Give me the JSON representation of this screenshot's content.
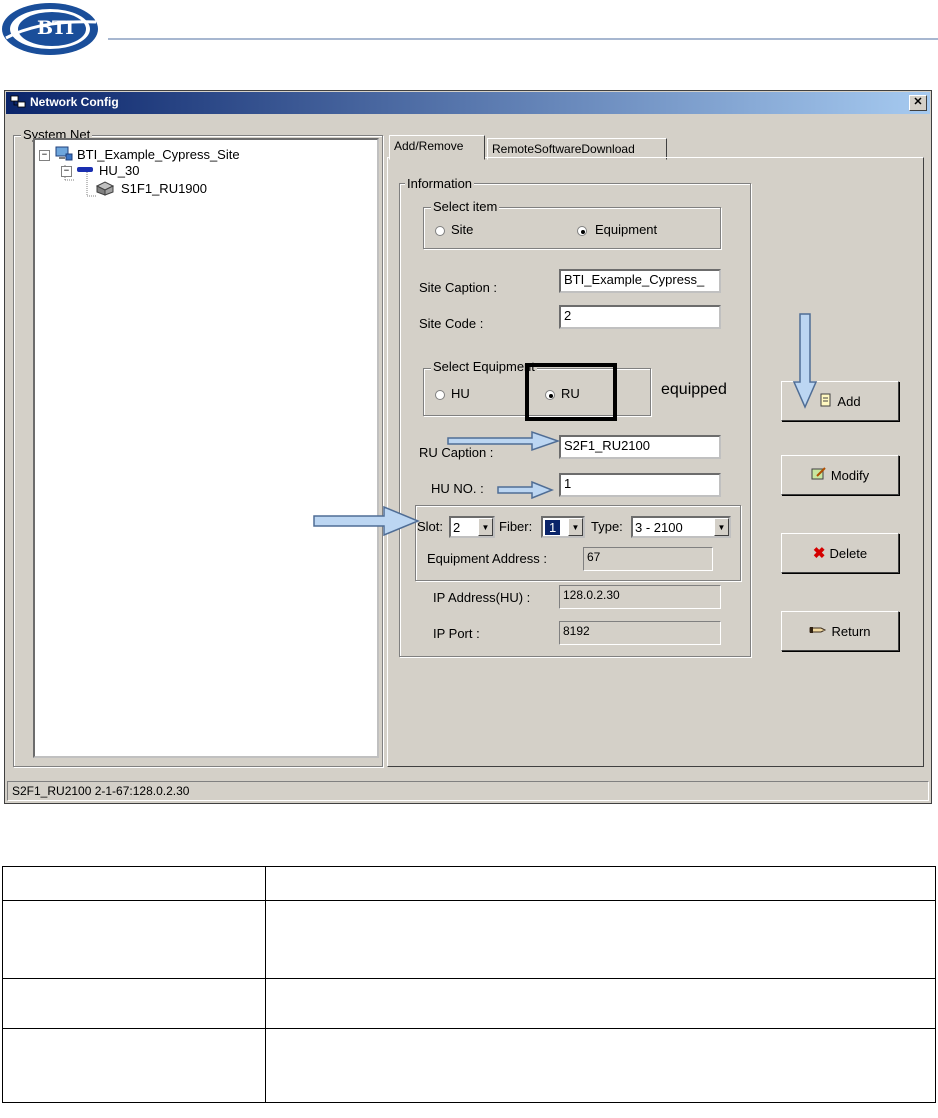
{
  "logo": {
    "text": "BTI"
  },
  "window": {
    "title": "Network Config",
    "close_label": "✕"
  },
  "system_net": {
    "label": "System Net",
    "tree": [
      {
        "label": "BTI_Example_Cypress_Site",
        "toggle": "−"
      },
      {
        "label": "HU_30",
        "toggle": "−"
      },
      {
        "label": "S1F1_RU1900"
      }
    ]
  },
  "tabs": [
    {
      "label": "Add/Remove",
      "active": true
    },
    {
      "label": "RemoteSoftwareDownload",
      "active": false
    }
  ],
  "information": {
    "label": "Information",
    "select_item": {
      "label": "Select item",
      "options": [
        "Site",
        "Equipment"
      ],
      "selected": "Equipment"
    },
    "site_caption": {
      "label": "Site Caption :",
      "value": "BTI_Example_Cypress_"
    },
    "site_code": {
      "label": "Site Code :",
      "value": "2"
    },
    "select_equipment": {
      "label": "Select Equipment",
      "options": [
        "HU",
        "RU"
      ],
      "selected": "RU",
      "note": "equipped"
    },
    "ru_caption": {
      "label": "RU Caption :",
      "value": "S2F1_RU2100"
    },
    "hu_no": {
      "label": "HU NO. :",
      "value": "1"
    },
    "slot": {
      "label": "Slot:",
      "value": "2"
    },
    "fiber": {
      "label": "Fiber:",
      "value": "1"
    },
    "type": {
      "label": "Type:",
      "value": "3 - 2100"
    },
    "equipment_address": {
      "label": "Equipment Address :",
      "value": "67"
    },
    "ip_address": {
      "label": "IP Address(HU) :",
      "value": "128.0.2.30"
    },
    "ip_port": {
      "label": "IP Port :",
      "value": "8192"
    }
  },
  "buttons": {
    "add": "Add",
    "modify": "Modify",
    "delete": "Delete",
    "return": "Return"
  },
  "status_bar": "S2F1_RU2100 2-1-67:128.0.2.30",
  "colors": {
    "titlebar_start": "#0a246a",
    "titlebar_end": "#a6caf0",
    "window_face": "#d4d0c8",
    "arrow_fill": "#bcd6f2",
    "arrow_stroke": "#4f6d95",
    "highlight_box": "#000000",
    "delete_icon": "#d40000"
  }
}
